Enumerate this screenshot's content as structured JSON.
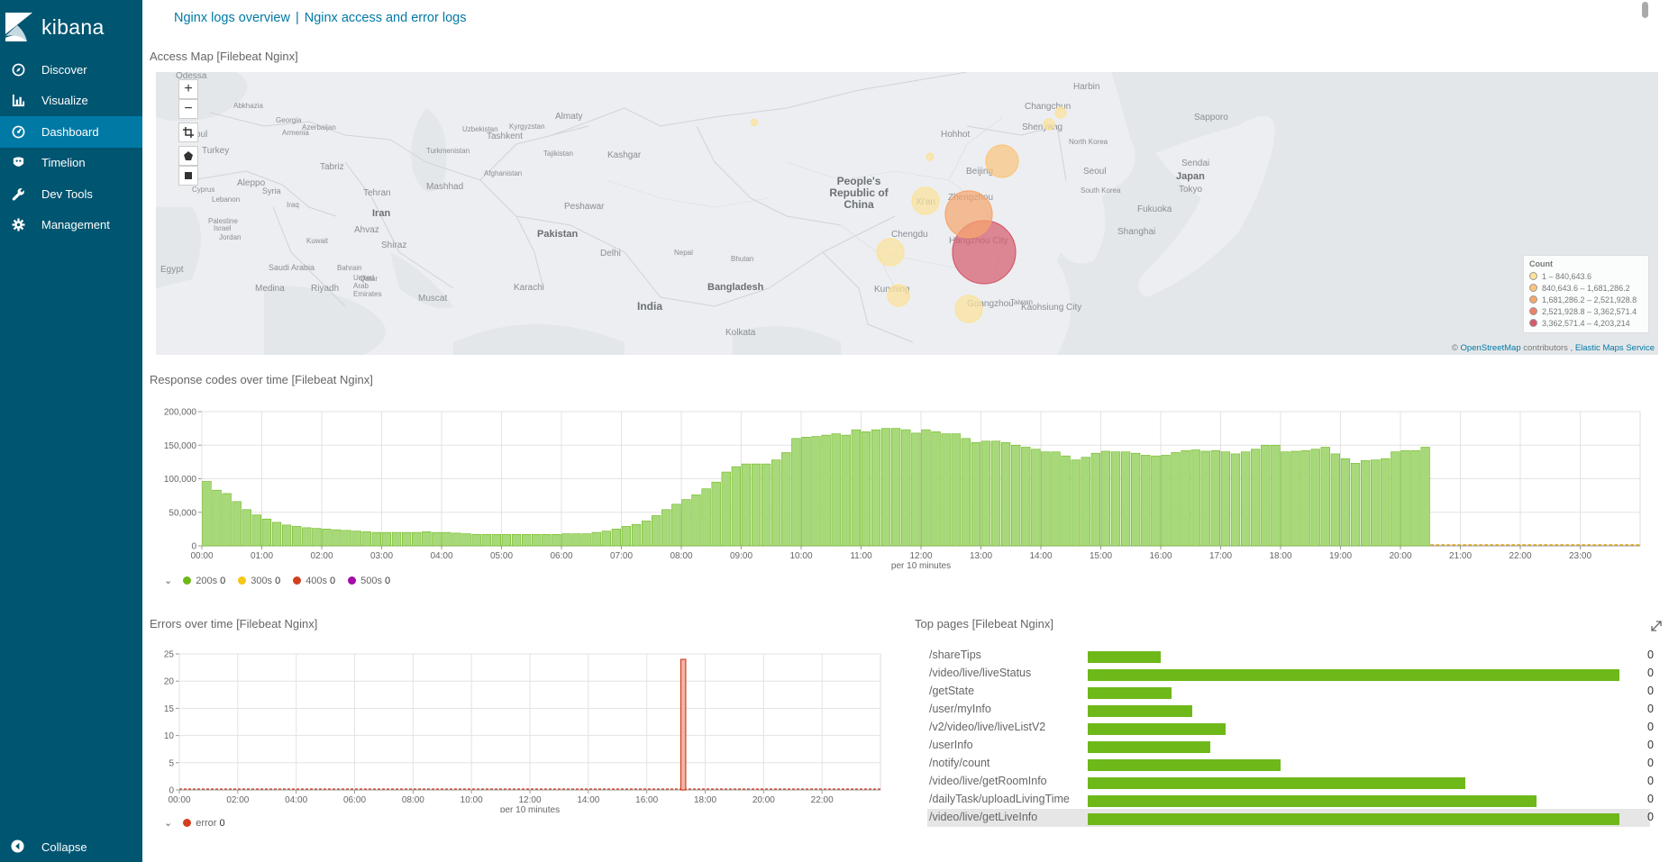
{
  "sidebar": {
    "brand": "kibana",
    "items": [
      {
        "label": "Discover",
        "icon": "compass-icon"
      },
      {
        "label": "Visualize",
        "icon": "bar-chart-icon"
      },
      {
        "label": "Dashboard",
        "icon": "dashboard-icon"
      },
      {
        "label": "Timelion",
        "icon": "timelion-icon"
      },
      {
        "label": "Dev Tools",
        "icon": "wrench-icon"
      },
      {
        "label": "Management",
        "icon": "gear-icon"
      }
    ],
    "active": "Dashboard",
    "collapse": "Collapse"
  },
  "breadcrumbs": [
    "Nginx logs overview",
    "Nginx access and error logs"
  ],
  "breadcrumb_sep": "|",
  "panels": {
    "map": {
      "title": "Access Map [Filebeat Nginx]",
      "legend_title": "Count",
      "legend_ranges": [
        "1 – 840,643.6",
        "840,643.6 – 1,681,286.2",
        "1,681,286.2 – 2,521,928.8",
        "2,521,928.8 – 3,362,571.4",
        "3,362,571.4 – 4,203,214"
      ],
      "legend_colors": [
        "#fce39a",
        "#fbc57c",
        "#f6a56c",
        "#ef7f69",
        "#d55a6c"
      ],
      "attribution_prefix": "©",
      "attribution_osm": "OpenStreetMap",
      "attribution_mid": "contributors ,",
      "attribution_ems": "Elastic Maps Service",
      "place_labels": [
        {
          "text": "Odessa",
          "size": 10
        },
        {
          "text": "Abkhazia",
          "size": 8
        },
        {
          "text": "Georgia",
          "size": 8
        },
        {
          "text": "Armenia",
          "size": 8
        },
        {
          "text": "Azerbaijan",
          "size": 8
        },
        {
          "text": "tanbul",
          "size": 10
        },
        {
          "text": "Turkey",
          "size": 10
        },
        {
          "text": "Aleppo",
          "size": 10
        },
        {
          "text": "Syria",
          "size": 9
        },
        {
          "text": "Cyprus",
          "size": 8
        },
        {
          "text": "Lebanon",
          "size": 8
        },
        {
          "text": "Palestine",
          "size": 8
        },
        {
          "text": "Israel",
          "size": 8
        },
        {
          "text": "Jordan",
          "size": 8
        },
        {
          "text": "Egypt",
          "size": 10
        },
        {
          "text": "Iraq",
          "size": 8
        },
        {
          "text": "Kuwait",
          "size": 8
        },
        {
          "text": "Saudi Arabia",
          "size": 9
        },
        {
          "text": "Medina",
          "size": 10
        },
        {
          "text": "Riyadh",
          "size": 10
        },
        {
          "text": "Bahrain",
          "size": 8
        },
        {
          "text": "Qatar",
          "size": 8
        },
        {
          "text": "United Arab Emirates",
          "size": 8
        },
        {
          "text": "Muscat",
          "size": 10
        },
        {
          "text": "Tabriz",
          "size": 10
        },
        {
          "text": "Tehran",
          "size": 10
        },
        {
          "text": "Iran",
          "size": 11
        },
        {
          "text": "Ahvaz",
          "size": 10
        },
        {
          "text": "Shiraz",
          "size": 10
        },
        {
          "text": "Mashhad",
          "size": 10
        },
        {
          "text": "Turkmenistan",
          "size": 8
        },
        {
          "text": "Uzbekistan",
          "size": 8
        },
        {
          "text": "Tashkent",
          "size": 10
        },
        {
          "text": "Kyrgyzstan",
          "size": 8
        },
        {
          "text": "Almaty",
          "size": 10
        },
        {
          "text": "Tajikistan",
          "size": 8
        },
        {
          "text": "Kashgar",
          "size": 10
        },
        {
          "text": "Afghanistan",
          "size": 8
        },
        {
          "text": "Peshawar",
          "size": 10
        },
        {
          "text": "Pakistan",
          "size": 11
        },
        {
          "text": "Karachi",
          "size": 10
        },
        {
          "text": "Delhi",
          "size": 10
        },
        {
          "text": "Nepal",
          "size": 8
        },
        {
          "text": "Bhutan",
          "size": 8
        },
        {
          "text": "India",
          "size": 12
        },
        {
          "text": "Bangladesh",
          "size": 11
        },
        {
          "text": "Kolkata",
          "size": 10
        },
        {
          "text": "People's Republic of China",
          "size": 12
        },
        {
          "text": "Xi'an",
          "size": 10
        },
        {
          "text": "Chengdu",
          "size": 10
        },
        {
          "text": "Kunming",
          "size": 10
        },
        {
          "text": "Zhengzhou",
          "size": 10
        },
        {
          "text": "Hohhot",
          "size": 10
        },
        {
          "text": "Beijing",
          "size": 10
        },
        {
          "text": "Shenyang",
          "size": 10
        },
        {
          "text": "Changchun",
          "size": 10
        },
        {
          "text": "Harbin",
          "size": 10
        },
        {
          "text": "North Korea",
          "size": 8
        },
        {
          "text": "Seoul",
          "size": 10
        },
        {
          "text": "South Korea",
          "size": 8
        },
        {
          "text": "Shanghai",
          "size": 10
        },
        {
          "text": "Hangzhou City",
          "size": 10
        },
        {
          "text": "Guangzhou",
          "size": 10
        },
        {
          "text": "Taiwan",
          "size": 8
        },
        {
          "text": "Kaohsiung City",
          "size": 10
        },
        {
          "text": "Fukuoka",
          "size": 10
        },
        {
          "text": "Tokyo",
          "size": 10
        },
        {
          "text": "Japan",
          "size": 11
        },
        {
          "text": "Sendai",
          "size": 10
        },
        {
          "text": "Sapporo",
          "size": 10
        }
      ],
      "bubbles": [
        {
          "label": "Hangzhou",
          "color": "#d55a6c",
          "r": 35
        },
        {
          "label": "Zhengzhou",
          "color": "#f6a56c",
          "r": 26
        },
        {
          "label": "Beijing",
          "color": "#fbc57c",
          "r": 18
        },
        {
          "label": "Xi'an",
          "color": "#fce39a",
          "r": 15
        },
        {
          "label": "Chengdu",
          "color": "#fce39a",
          "r": 15
        },
        {
          "label": "Guangzhou",
          "color": "#fce39a",
          "r": 15
        },
        {
          "label": "Kunming",
          "color": "#fce39a",
          "r": 12
        },
        {
          "label": "Harbin",
          "color": "#fce39a",
          "r": 6
        },
        {
          "label": "Changchun",
          "color": "#fce39a",
          "r": 6
        },
        {
          "label": "Hohhot",
          "color": "#fce39a",
          "r": 4
        },
        {
          "label": "Almaty",
          "color": "#fce39a",
          "r": 3.5
        }
      ]
    },
    "response_codes": {
      "title": "Response codes over time [Filebeat Nginx]",
      "legend": [
        {
          "label": "200s",
          "value": "0",
          "color": "#6eb81a"
        },
        {
          "label": "300s",
          "value": "0",
          "color": "#f5c518"
        },
        {
          "label": "400s",
          "value": "0",
          "color": "#d23f1f"
        },
        {
          "label": "500s",
          "value": "0",
          "color": "#a30ca8"
        }
      ]
    },
    "errors": {
      "title": "Errors over time [Filebeat Nginx]",
      "legend": [
        {
          "label": "error",
          "value": "0",
          "color": "#d23f1f"
        }
      ]
    },
    "top_pages": {
      "title": "Top pages [Filebeat Nginx]",
      "rows": [
        {
          "label": "/shareTips",
          "value": "0",
          "fill": 0.138
        },
        {
          "label": "/video/live/liveStatus",
          "value": "0",
          "fill": 1.0
        },
        {
          "label": "/getState",
          "value": "0",
          "fill": 0.158
        },
        {
          "label": "/user/myInfo",
          "value": "0",
          "fill": 0.197
        },
        {
          "label": "/v2/video/live/liveListV2",
          "value": "0",
          "fill": 0.259
        },
        {
          "label": "/userInfo",
          "value": "0",
          "fill": 0.23
        },
        {
          "label": "/notify/count",
          "value": "0",
          "fill": 0.362
        },
        {
          "label": "/video/live/getRoomInfo",
          "value": "0",
          "fill": 0.71
        },
        {
          "label": "/dailyTask/uploadLivingTime",
          "value": "0",
          "fill": 0.844
        },
        {
          "label": "/video/live/getLiveInfo",
          "value": "0",
          "fill": 1.0
        }
      ],
      "highlighted_row": "/video/live/getLiveInfo"
    }
  },
  "chart_data": [
    {
      "type": "bar",
      "title": "Response codes over time [Filebeat Nginx]",
      "xlabel": "per 10 minutes",
      "ylabel": "",
      "ylim": [
        0,
        200000
      ],
      "yticks": [
        0,
        50000,
        100000,
        150000,
        200000
      ],
      "ytick_labels": [
        "0",
        "50,000",
        "100,000",
        "150,000",
        "200,000"
      ],
      "xticks_hours": [
        0,
        1,
        2,
        3,
        4,
        5,
        6,
        7,
        8,
        9,
        10,
        11,
        12,
        13,
        14,
        15,
        16,
        17,
        18,
        19,
        20,
        21,
        22,
        23
      ],
      "xtick_labels": [
        "00:00",
        "01:00",
        "02:00",
        "03:00",
        "04:00",
        "05:00",
        "06:00",
        "07:00",
        "08:00",
        "09:00",
        "10:00",
        "11:00",
        "12:00",
        "13:00",
        "14:00",
        "15:00",
        "16:00",
        "17:00",
        "18:00",
        "19:00",
        "20:00",
        "21:00",
        "22:00",
        "23:00"
      ],
      "x_interval_minutes": 10,
      "series": [
        {
          "name": "200s",
          "values": [
            96000,
            83000,
            78000,
            66000,
            54000,
            46000,
            40000,
            35000,
            31000,
            29000,
            27000,
            26000,
            25000,
            24000,
            23000,
            22000,
            21000,
            20000,
            20000,
            20000,
            20000,
            20000,
            21000,
            20000,
            20000,
            19000,
            18000,
            17000,
            17000,
            17000,
            17000,
            17000,
            17000,
            17000,
            17000,
            17000,
            18000,
            18000,
            18000,
            20000,
            22000,
            25000,
            29000,
            32000,
            37000,
            45000,
            54000,
            62000,
            69000,
            76000,
            85000,
            95000,
            110000,
            118000,
            122000,
            122000,
            122000,
            128000,
            139000,
            160000,
            162000,
            163000,
            165000,
            167000,
            165000,
            173000,
            170000,
            173000,
            175000,
            175000,
            173000,
            168000,
            173000,
            170000,
            167000,
            167000,
            160000,
            154000,
            156000,
            156000,
            154000,
            150000,
            147000,
            144000,
            140000,
            140000,
            134000,
            128000,
            132000,
            138000,
            141000,
            140000,
            140000,
            138000,
            135000,
            134000,
            135000,
            139000,
            142000,
            143000,
            141000,
            142000,
            140000,
            137000,
            140000,
            144000,
            150000,
            150000,
            140000,
            141000,
            142000,
            144000,
            147000,
            137000,
            130000,
            123000,
            127000,
            128000,
            130000,
            140000,
            142000,
            142000,
            147000
          ]
        }
      ]
    },
    {
      "type": "bar",
      "title": "Errors over time [Filebeat Nginx]",
      "xlabel": "per 10 minutes",
      "ylabel": "",
      "ylim": [
        0,
        25
      ],
      "yticks": [
        0,
        5,
        10,
        15,
        20,
        25
      ],
      "ytick_labels": [
        "0",
        "5",
        "10",
        "15",
        "20",
        "25"
      ],
      "xtick_labels": [
        "00:00",
        "02:00",
        "04:00",
        "06:00",
        "08:00",
        "10:00",
        "12:00",
        "14:00",
        "16:00",
        "18:00",
        "20:00",
        "22:00"
      ],
      "xticks_hours": [
        0,
        2,
        4,
        6,
        8,
        10,
        12,
        14,
        16,
        18,
        20,
        22
      ],
      "x_interval_minutes": 10,
      "series": [
        {
          "name": "error",
          "points": [
            {
              "time": "17:10",
              "value": 24
            }
          ]
        }
      ]
    }
  ]
}
